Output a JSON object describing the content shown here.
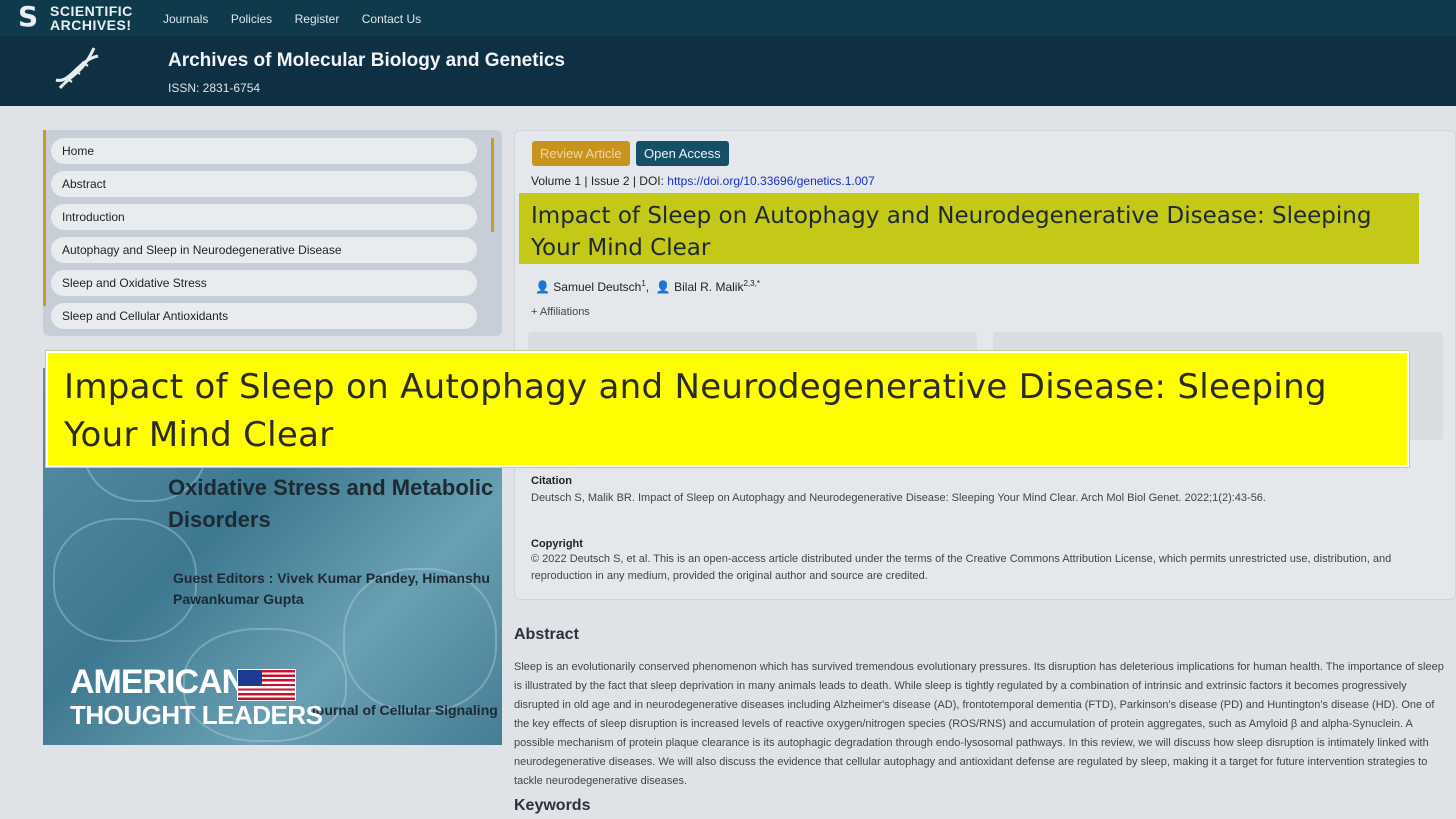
{
  "topnav": {
    "logo_line1": "SCIENTIFIC",
    "logo_line2": "ARCHIVES!",
    "links": [
      "Journals",
      "Policies",
      "Register",
      "Contact Us"
    ]
  },
  "banner": {
    "journal_title": "Archives of Molecular Biology and Genetics",
    "issn": "ISSN: 2831-6754"
  },
  "sidebar": {
    "items": [
      {
        "label": "Home"
      },
      {
        "label": "Abstract"
      },
      {
        "label": "Introduction"
      },
      {
        "label": "Autophagy and Sleep in Neurodegenerative Disease"
      },
      {
        "label": "Sleep and Oxidative Stress"
      },
      {
        "label": "Sleep and Cellular Antioxidants"
      }
    ]
  },
  "cover": {
    "title_line1": "Oxidative Stress and Metabolic",
    "title_line2": "Disorders",
    "editors_line1": "Guest Editors : Vivek Kumar Pandey, Himanshu",
    "editors_line2": "Pawankumar Gupta",
    "journal": "Journal of Cellular Signaling"
  },
  "watermark": {
    "line1": "AMERICAN",
    "line2": "THOUGHT LEADERS"
  },
  "article": {
    "badge_review": "Review Article",
    "badge_open_access": "Open Access",
    "volume_text": "Volume 1 | Issue 2 | DOI: ",
    "doi": "https://doi.org/10.33696/genetics.1.007",
    "title": "Impact of Sleep on Autophagy and Neurodegenerative Disease: Sleeping Your Mind Clear",
    "author1": "Samuel Deutsch",
    "author1_sup": "1",
    "author2": "Bilal R. Malik",
    "author2_sup": "2,3,*",
    "affiliations": "+ Affiliations",
    "citation_label": "Citation",
    "citation_text": "Deutsch S, Malik BR. Impact of Sleep on Autophagy and Neurodegenerative Disease: Sleeping Your Mind Clear. Arch Mol Biol Genet. 2022;1(2):43-56.",
    "copyright_label": "Copyright",
    "copyright_text": "© 2022 Deutsch S, et al. This is an open-access article distributed under the terms of the Creative Commons Attribution License, which permits unrestricted use, distribution, and reproduction in any medium, provided the original author and source are credited."
  },
  "abstract": {
    "heading": "Abstract",
    "text": "Sleep is an evolutionarily conserved phenomenon which has survived tremendous evolutionary pressures. Its disruption has deleterious implications for human health. The importance of sleep is illustrated by the fact that sleep deprivation in many animals leads to death. While sleep is tightly regulated by a combination of intrinsic and extrinsic factors it becomes progressively disrupted in old age and in neurodegenerative diseases including Alzheimer's disease (AD), frontotemporal dementia (FTD), Parkinson's disease (PD) and Huntington's disease (HD). One of the key effects of sleep disruption is increased levels of reactive oxygen/nitrogen species (ROS/RNS) and accumulation of protein aggregates, such as Amyloid β and alpha-Synuclein. A possible mechanism of protein plaque clearance is its autophagic degradation through endo-lysosomal pathways. In this review, we will discuss how sleep disruption is intimately linked with neurodegenerative diseases. We will also discuss the evidence that cellular autophagy and antioxidant defense are regulated by sleep, making it a target for future intervention strategies to tackle neurodegenerative diseases."
  },
  "keywords": {
    "heading": "Keywords"
  },
  "overlay": {
    "title": "Impact of Sleep on Autophagy and Neurodegenerative Disease: Sleeping Your Mind Clear"
  },
  "colors": {
    "nav_bg": "#0e3a4c",
    "banner_bg": "#0f2f43",
    "badge_review": "#c9931f",
    "badge_open_access": "#155066",
    "title_highlight": "#c4c817",
    "overlay_yellow": "#ffff00"
  }
}
